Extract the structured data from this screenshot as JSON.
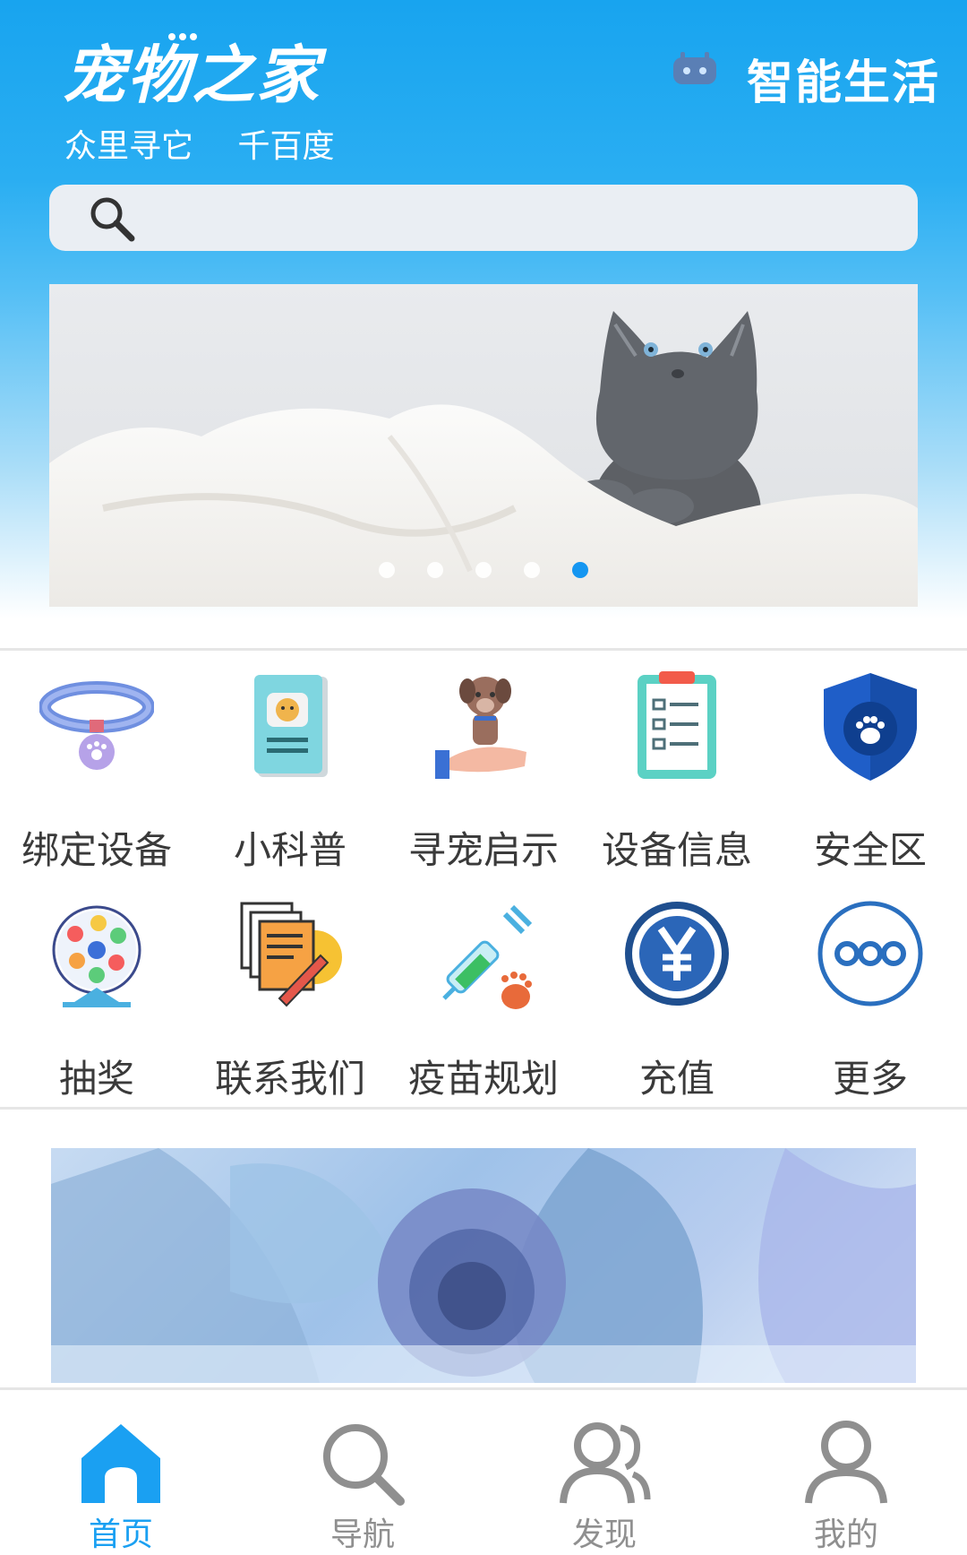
{
  "header": {
    "app_title": "宠物之家",
    "slogan_1": "众里寻它",
    "slogan_2": "千百度",
    "smart_life": "智能生活",
    "robot_icon": "robot-icon"
  },
  "search": {
    "placeholder": "",
    "icon": "search-icon"
  },
  "carousel": {
    "slide_count": 5,
    "active_index": 4
  },
  "grid": [
    {
      "label": "绑定设备",
      "icon": "collar-icon"
    },
    {
      "label": "小科普",
      "icon": "pet-book-icon"
    },
    {
      "label": "寻宠启示",
      "icon": "dog-in-hand-icon"
    },
    {
      "label": "设备信息",
      "icon": "clipboard-list-icon"
    },
    {
      "label": "安全区",
      "icon": "shield-paw-icon"
    },
    {
      "label": "抽奖",
      "icon": "lottery-wheel-icon"
    },
    {
      "label": "联系我们",
      "icon": "documents-pen-icon"
    },
    {
      "label": "疫苗规划",
      "icon": "syringe-icon"
    },
    {
      "label": "充值",
      "icon": "yuan-coin-icon"
    },
    {
      "label": "更多",
      "icon": "more-dots-icon"
    }
  ],
  "bottom_nav": [
    {
      "label": "首页",
      "icon": "home-icon",
      "active": true
    },
    {
      "label": "导航",
      "icon": "search-icon",
      "active": false
    },
    {
      "label": "发现",
      "icon": "users-icon",
      "active": false
    },
    {
      "label": "我的",
      "icon": "user-icon",
      "active": false
    }
  ],
  "colors": {
    "primary": "#1aa0f2",
    "inactive": "#8f8f8f",
    "text": "#3a3a3a"
  }
}
